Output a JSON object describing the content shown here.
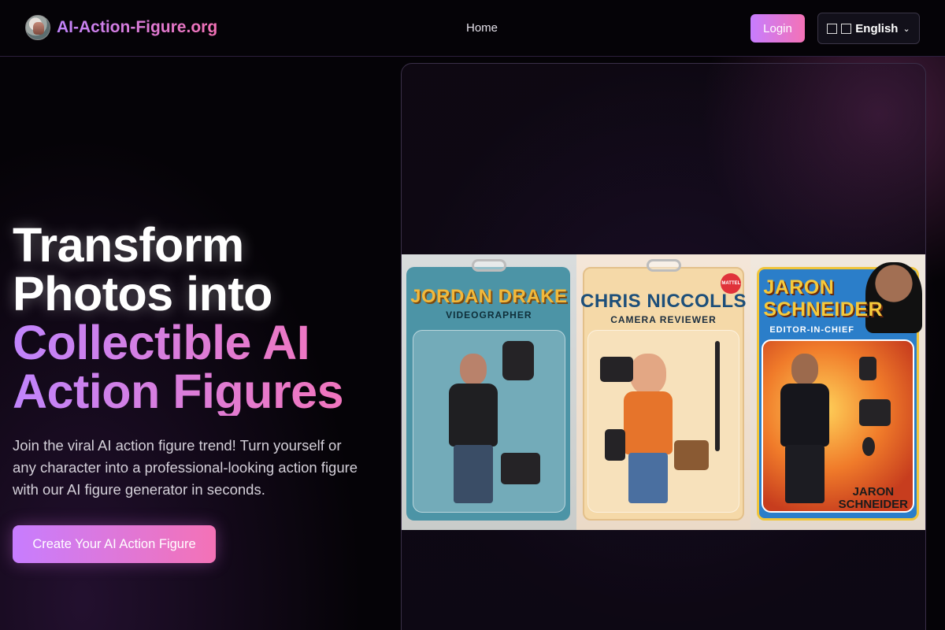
{
  "header": {
    "brand": "AI-Action-Figure.org",
    "nav": [
      {
        "label": "Home"
      }
    ],
    "login_label": "Login",
    "language": {
      "selected": "English",
      "flag_glyph": "",
      "icon": "chevron-down-icon"
    }
  },
  "hero": {
    "title_line1": "Transform",
    "title_line2": "Photos into",
    "title_line3": "Collectible AI",
    "title_line4": "Action Figures",
    "subtitle": "Join the viral AI action figure trend! Turn yourself or any character into a professional-looking action figure with our AI figure generator in seconds.",
    "cta_label": "Create Your AI Action Figure"
  },
  "showcase": {
    "packs": [
      {
        "name": "JORDAN DRAKE",
        "role": "VIDEOGRAPHER"
      },
      {
        "name": "CHRIS NICCOLLS",
        "role": "CAMERA REVIEWER",
        "badge": "MATTEL"
      },
      {
        "name_line1": "JARON",
        "name_line2": "SCHNEIDER",
        "role": "EDITOR-IN-CHIEF",
        "footer_line1": "JARON",
        "footer_line2": "SCHNEIDER"
      }
    ]
  },
  "colors": {
    "accent_start": "#c77dff",
    "accent_end": "#f472b6",
    "background": "#050307"
  }
}
